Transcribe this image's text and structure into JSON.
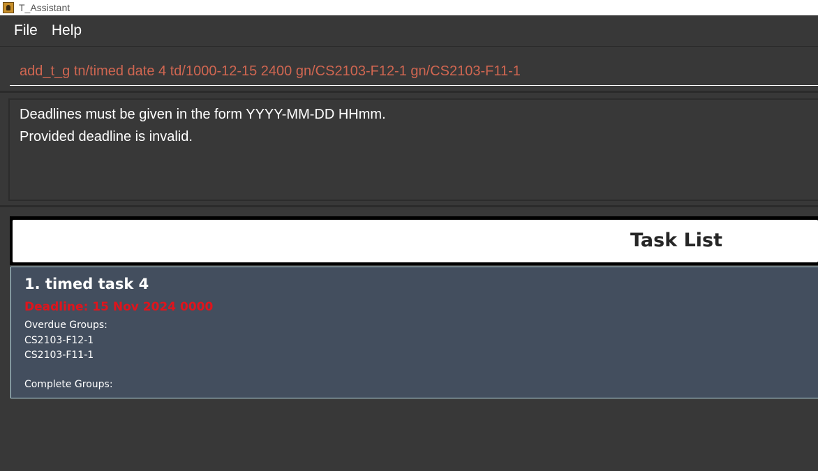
{
  "window": {
    "title": "T_Assistant",
    "icon": "app-icon"
  },
  "menu": {
    "items": [
      "File",
      "Help"
    ]
  },
  "command": {
    "value": "add_t_g tn/timed date 4 td/1000-12-15 2400 gn/CS2103-F12-1 gn/CS2103-F11-1"
  },
  "result": {
    "lines": [
      "Deadlines must be given in the form YYYY-MM-DD HHmm.",
      "Provided deadline is invalid."
    ]
  },
  "task_list": {
    "header": "Task List",
    "tasks": [
      {
        "title": "1. timed task 4",
        "deadline": "Deadline: 15 Nov 2024 0000",
        "overdue_label": "Overdue Groups:",
        "overdue_groups": [
          "CS2103-F12-1",
          "CS2103-F11-1"
        ],
        "complete_label": "Complete Groups:"
      }
    ]
  },
  "colors": {
    "background": "#383838",
    "command_text": "#d06651",
    "deadline_text": "#e0141c",
    "card_background": "#434e5e",
    "card_border": "#bfe3ef"
  }
}
